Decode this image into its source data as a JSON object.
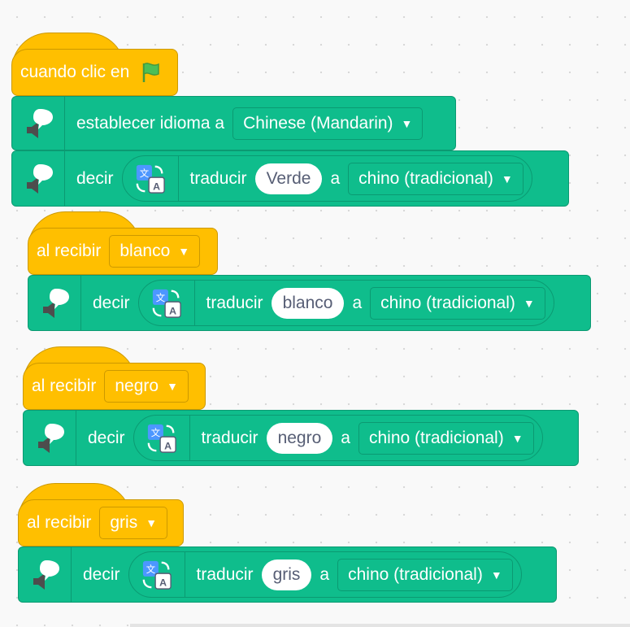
{
  "script1": {
    "hat_label": "cuando clic en",
    "flag_icon": "green-flag-icon",
    "set_lang": {
      "label": "establecer idioma a",
      "value": "Chinese (Mandarin)"
    },
    "say": {
      "label": "decir",
      "translate_label": "traducir",
      "text": "Verde",
      "to": "a",
      "lang": "chino (tradicional)"
    }
  },
  "script2": {
    "hat_label": "al recibir",
    "message": "blanco",
    "say": {
      "label": "decir",
      "translate_label": "traducir",
      "text": "blanco",
      "to": "a",
      "lang": "chino (tradicional)"
    }
  },
  "script3": {
    "hat_label": "al recibir",
    "message": "negro",
    "say": {
      "label": "decir",
      "translate_label": "traducir",
      "text": "negro",
      "to": "a",
      "lang": "chino (tradicional)"
    }
  },
  "script4": {
    "hat_label": "al recibir",
    "message": "gris",
    "say": {
      "label": "decir",
      "translate_label": "traducir",
      "text": "gris",
      "to": "a",
      "lang": "chino (tradicional)"
    }
  },
  "colors": {
    "events": "#ffbf00",
    "extension": "#0fbd8c"
  }
}
